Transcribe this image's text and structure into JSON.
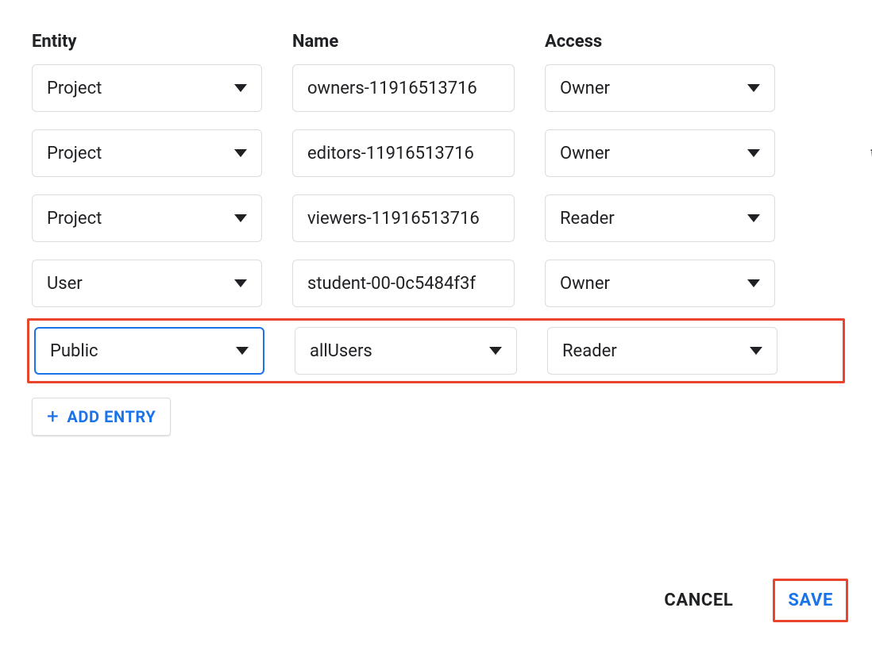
{
  "headers": {
    "entity": "Entity",
    "name": "Name",
    "access": "Access"
  },
  "rows": [
    {
      "entity": "Project",
      "name": "owners-11916513716",
      "access": "Owner",
      "deletable": false,
      "name_dropdown": false,
      "focused": false,
      "highlighted": false
    },
    {
      "entity": "Project",
      "name": "editors-11916513716",
      "access": "Owner",
      "deletable": true,
      "name_dropdown": false,
      "focused": false,
      "highlighted": false
    },
    {
      "entity": "Project",
      "name": "viewers-11916513716",
      "access": "Reader",
      "deletable": false,
      "name_dropdown": false,
      "focused": false,
      "highlighted": false
    },
    {
      "entity": "User",
      "name": "student-00-0c5484f3f",
      "access": "Owner",
      "deletable": false,
      "name_dropdown": false,
      "focused": false,
      "highlighted": false
    },
    {
      "entity": "Public",
      "name": "allUsers",
      "access": "Reader",
      "deletable": true,
      "name_dropdown": true,
      "focused": true,
      "highlighted": true
    }
  ],
  "buttons": {
    "add_entry": "ADD ENTRY",
    "cancel": "CANCEL",
    "save": "SAVE"
  }
}
